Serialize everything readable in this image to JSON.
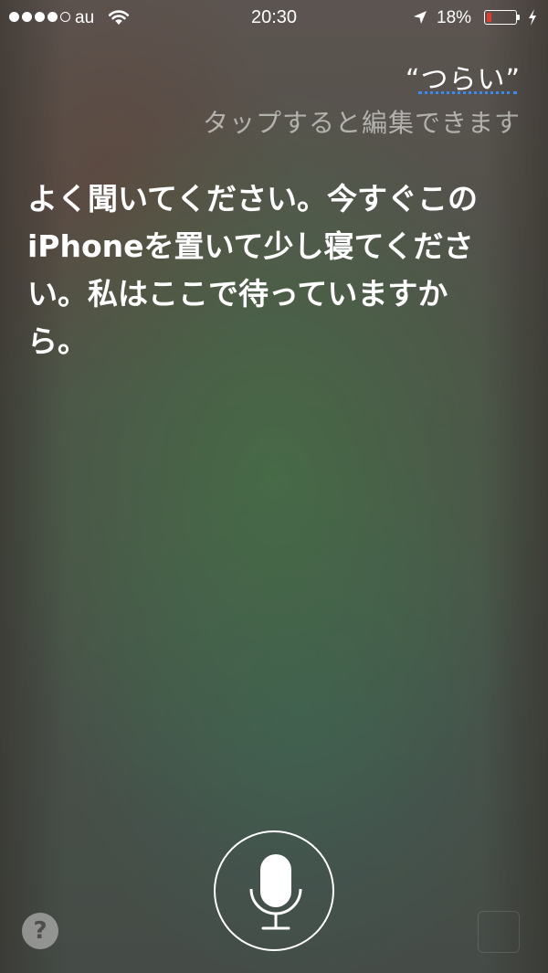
{
  "status_bar": {
    "carrier": "au",
    "time": "20:30",
    "battery_percent": "18%",
    "battery_level": 0.18,
    "battery_color": "#e63a2c",
    "signal_bars_filled": 4,
    "signal_bars_total": 5,
    "icons": [
      "wifi-icon",
      "location-arrow-icon",
      "battery-icon",
      "charging-bolt-icon"
    ]
  },
  "siri": {
    "query": "“つらい”",
    "tap_hint": "タップすると編集できます",
    "response": "よく聞いてください。今すぐこのiPhoneを置いて少し寝てください。私はここで待っていますから。",
    "accent_color": "#3a8cf0"
  },
  "controls": {
    "help_label": "?",
    "mic_icon": "microphone-icon"
  }
}
